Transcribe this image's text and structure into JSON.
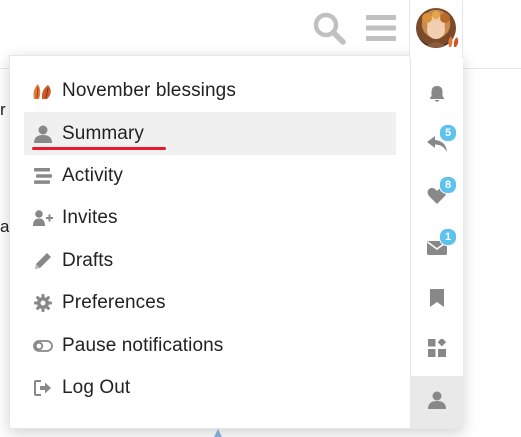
{
  "header": {
    "search_icon": "search-icon",
    "menu_icon": "hamburger-icon",
    "avatar_icon": "user-avatar"
  },
  "background_text": {
    "frag1": "r",
    "frag2": "a"
  },
  "menu": {
    "items": [
      {
        "label": "November blessings",
        "icon": "leaves-emoji-icon"
      },
      {
        "label": "Summary",
        "icon": "user-icon"
      },
      {
        "label": "Activity",
        "icon": "stream-icon"
      },
      {
        "label": "Invites",
        "icon": "user-plus-icon"
      },
      {
        "label": "Drafts",
        "icon": "pencil-icon"
      },
      {
        "label": "Preferences",
        "icon": "gear-icon"
      },
      {
        "label": "Pause notifications",
        "icon": "toggle-off-icon"
      },
      {
        "label": "Log Out",
        "icon": "sign-out-icon"
      }
    ],
    "active_item": "Summary"
  },
  "tabs": {
    "items": [
      {
        "name": "notifications",
        "icon": "bell-icon",
        "count": ""
      },
      {
        "name": "replies",
        "icon": "reply-icon",
        "count": "5"
      },
      {
        "name": "likes",
        "icon": "heart-icon",
        "count": "8"
      },
      {
        "name": "messages",
        "icon": "envelope-icon",
        "count": "1"
      },
      {
        "name": "bookmarks",
        "icon": "bookmark-icon",
        "count": ""
      },
      {
        "name": "review",
        "icon": "widgets-icon",
        "count": ""
      },
      {
        "name": "profile",
        "icon": "user-icon",
        "count": ""
      }
    ],
    "active_tab": "profile"
  },
  "colors": {
    "accent_badge": "#5ec2f0",
    "underline": "#e8182e",
    "icon_gray": "#888888",
    "header_icon_gray": "#c0c0c0"
  }
}
